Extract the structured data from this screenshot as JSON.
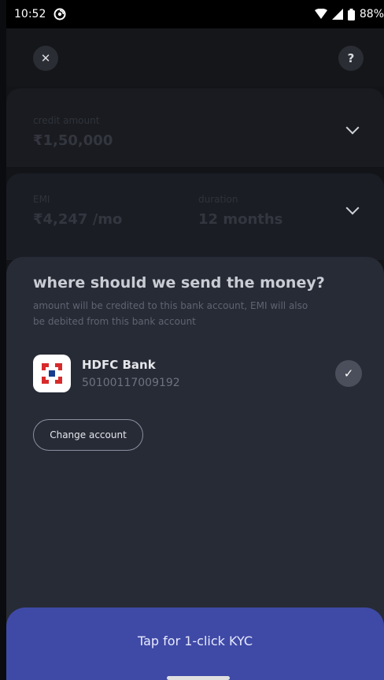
{
  "status_bar": {
    "time": "10:52",
    "battery": "88%"
  },
  "credit": {
    "label": "credit amount",
    "value": "₹1,50,000"
  },
  "emi": {
    "label": "EMI",
    "value": "₹4,247 /mo",
    "duration_label": "duration",
    "duration_value": "12 months"
  },
  "sheet": {
    "title": "where should we send the money?",
    "subtitle": "amount will be credited to this bank account, EMI will also be debited from this bank account"
  },
  "bank": {
    "name": "HDFC Bank",
    "account_number": "50100117009192"
  },
  "change_account_label": "Change account",
  "cta_label": "Tap for 1-click KYC",
  "colors": {
    "cta": "#3f4aa6",
    "sheet": "#272b36",
    "bank_red": "#d72b2b",
    "bank_blue": "#1a3c8f"
  }
}
